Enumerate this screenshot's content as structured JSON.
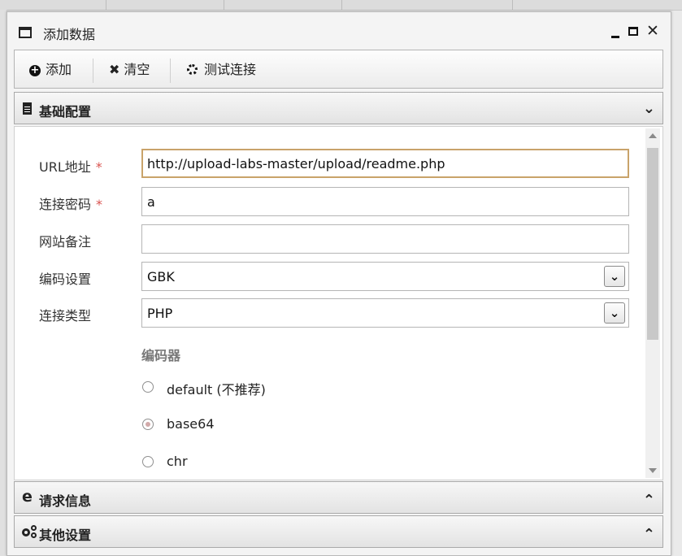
{
  "window": {
    "title": "添加数据"
  },
  "toolbar": {
    "add_label": "添加",
    "clear_label": "清空",
    "test_label": "测试连接"
  },
  "sections": {
    "basic": {
      "title": "基础配置"
    },
    "request": {
      "title": "请求信息"
    },
    "other": {
      "title": "其他设置"
    }
  },
  "form": {
    "url": {
      "label": "URL地址",
      "required_mark": "*",
      "value": "http://upload-labs-master/upload/readme.php"
    },
    "password": {
      "label": "连接密码",
      "required_mark": "*",
      "value": "a"
    },
    "note": {
      "label": "网站备注",
      "value": ""
    },
    "encoding": {
      "label": "编码设置",
      "value": "GBK"
    },
    "type": {
      "label": "连接类型",
      "value": "PHP"
    },
    "encoder": {
      "label": "编码器",
      "options": [
        "default (不推荐)",
        "base64",
        "chr"
      ],
      "selected": "base64"
    }
  },
  "colors": {
    "accent_border": "#c9a36a",
    "required": "#d9534f"
  }
}
